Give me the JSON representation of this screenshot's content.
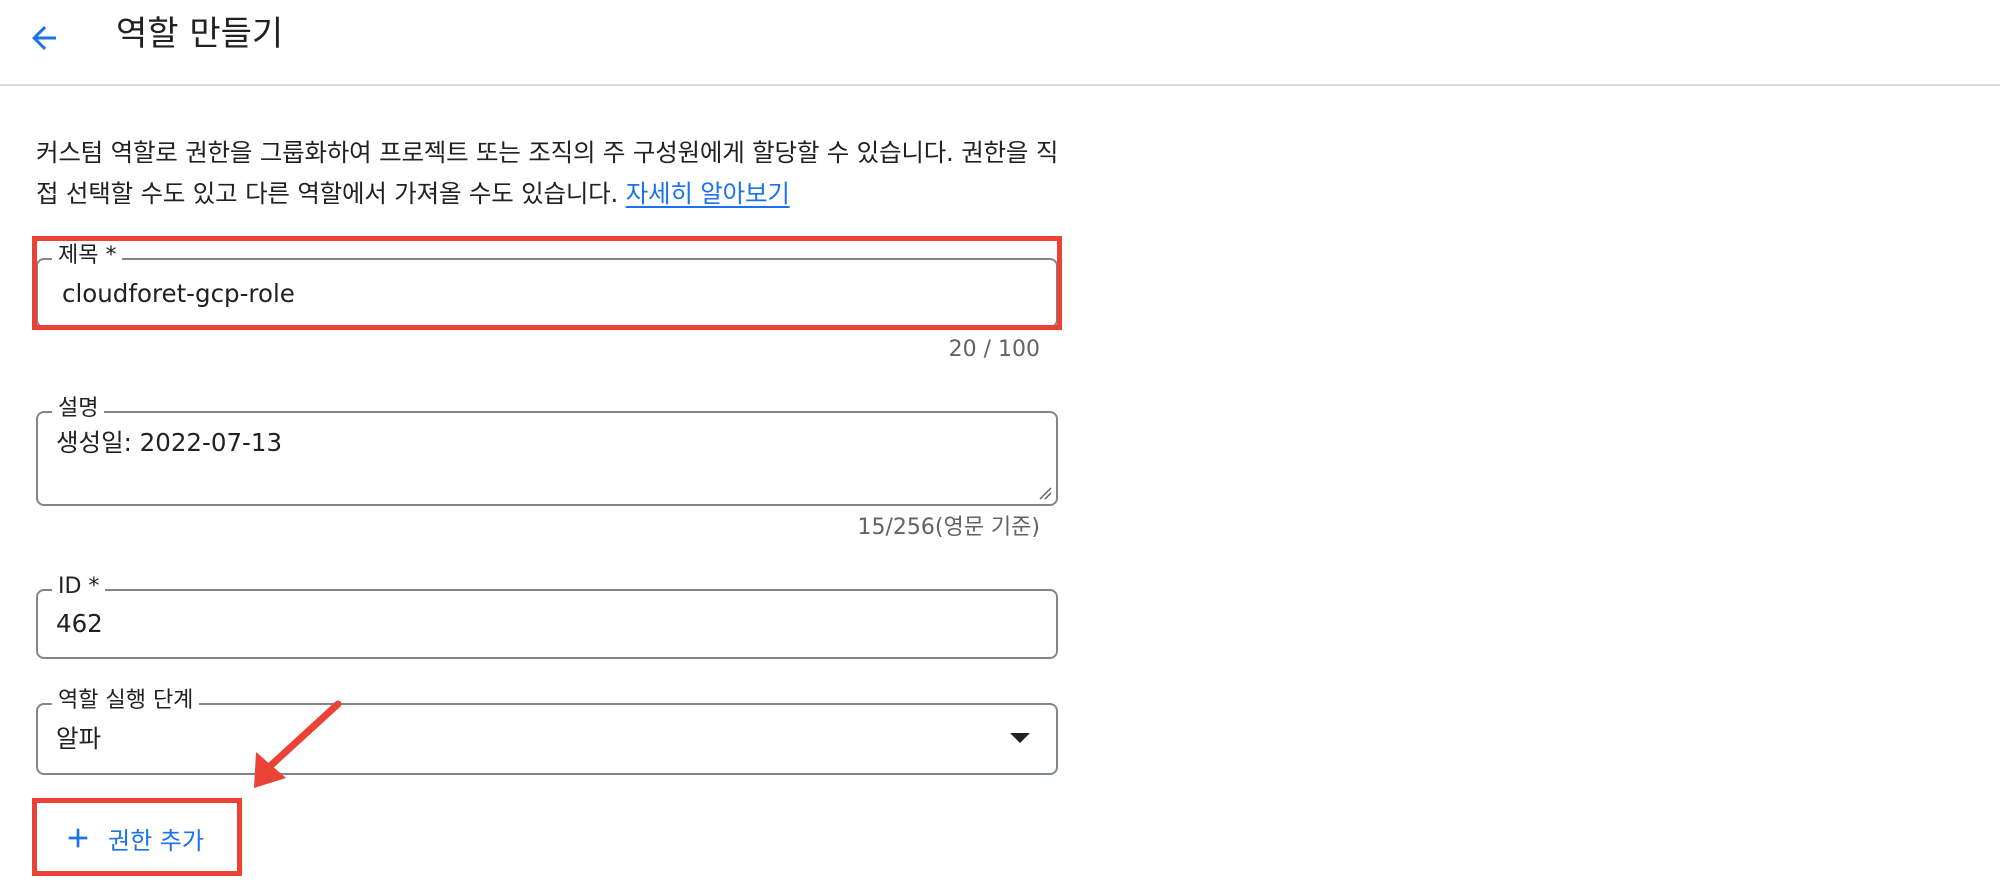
{
  "header": {
    "back_icon": "arrow-back-icon",
    "title": "역할 만들기"
  },
  "intro": {
    "text": "커스텀 역할로 권한을 그룹화하여 프로젝트 또는 조직의 주 구성원에게 할당할 수 있습니다. 권한을 직접 선택할 수도 있고 다른 역할에서 가져올 수도 있습니다.",
    "link_label": "자세히 알아보기"
  },
  "form": {
    "title_field": {
      "label": "제목 *",
      "value": "cloudforet-gcp-role",
      "counter": "20 / 100"
    },
    "description_field": {
      "label": "설명",
      "value": "생성일: 2022-07-13",
      "counter": "15/256(영문 기준)"
    },
    "id_field": {
      "label": "ID *",
      "value": "462"
    },
    "stage_field": {
      "label": "역할 실행 단계",
      "value": "알파",
      "icon": "arrow-drop-down-icon"
    },
    "add_permission": {
      "icon": "plus-icon",
      "label": "권한 추가"
    }
  },
  "colors": {
    "accent": "#1a73e8",
    "annotation": "#ea4335",
    "text": "#202124",
    "secondary_text": "#5f6368",
    "border": "#80868b"
  }
}
